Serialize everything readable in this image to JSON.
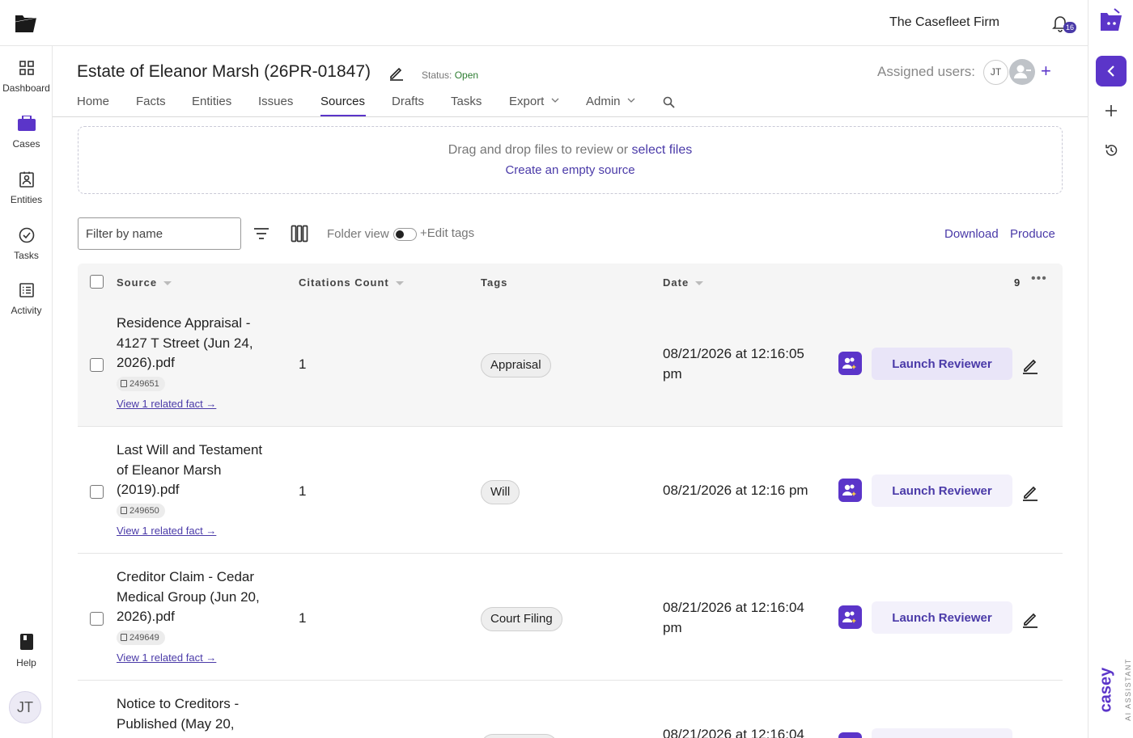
{
  "topbar": {
    "firm_name": "The Casefleet Firm",
    "notification_count": "16"
  },
  "leftnav": {
    "items": [
      {
        "label": "Dashboard",
        "icon": "grid-icon"
      },
      {
        "label": "Cases",
        "icon": "briefcase-icon"
      },
      {
        "label": "Entities",
        "icon": "contact-card-icon"
      },
      {
        "label": "Tasks",
        "icon": "check-circle-icon"
      },
      {
        "label": "Activity",
        "icon": "list-icon"
      },
      {
        "label": "Help",
        "icon": "book-icon"
      }
    ],
    "user_initials": "JT"
  },
  "case": {
    "title": "Estate of Eleanor Marsh (26PR-01847)",
    "status_label": "Status:",
    "status_value": "Open",
    "assigned_label": "Assigned users:",
    "assigned_initials": "JT"
  },
  "tabs": [
    "Home",
    "Facts",
    "Entities",
    "Issues",
    "Sources",
    "Drafts",
    "Tasks",
    "Export",
    "Admin"
  ],
  "active_tab": "Sources",
  "dropzone": {
    "text": "Drag and drop files to review or",
    "select_link": "select files",
    "create_link": "Create an empty source"
  },
  "toolbar": {
    "filter_placeholder": "Filter by name",
    "folder_view_label": "Folder view",
    "folder_view_on": false,
    "edit_tags_label": "+Edit tags",
    "download_label": "Download",
    "produce_label": "Produce"
  },
  "table": {
    "headers": {
      "source": "Source",
      "citations": "Citations Count",
      "tags": "Tags",
      "date": "Date"
    },
    "total_count": "9",
    "more_label": "•••",
    "rows": [
      {
        "name": "Residence Appraisal - 4127 T Street (Jun 24, 2026).pdf",
        "id": "249651",
        "related": "View 1 related fact →",
        "citations": "1",
        "tag": "Appraisal",
        "date": "08/21/2026 at 12:16:05 pm",
        "action": "Launch Reviewer"
      },
      {
        "name": "Last Will and Testament of Eleanor Marsh (2019).pdf",
        "id": "249650",
        "related": "View 1 related fact →",
        "citations": "1",
        "tag": "Will",
        "date": "08/21/2026 at 12:16 pm",
        "action": "Launch Reviewer"
      },
      {
        "name": "Creditor Claim - Cedar Medical Group (Jun 20, 2026).pdf",
        "id": "249649",
        "related": "View 1 related fact →",
        "citations": "1",
        "tag": "Court Filing",
        "date": "08/21/2026 at 12:16:04 pm",
        "action": "Launch Reviewer"
      },
      {
        "name": "Notice to Creditors - Published (May 20,",
        "date": "08/21/2026 at 12:16:04"
      }
    ]
  },
  "assistant": {
    "name": "casey",
    "subtitle": "AI ASSISTANT"
  },
  "colors": {
    "accent": "#5b35c9",
    "link": "#4a3aa8",
    "status_open": "#2e7d32"
  }
}
